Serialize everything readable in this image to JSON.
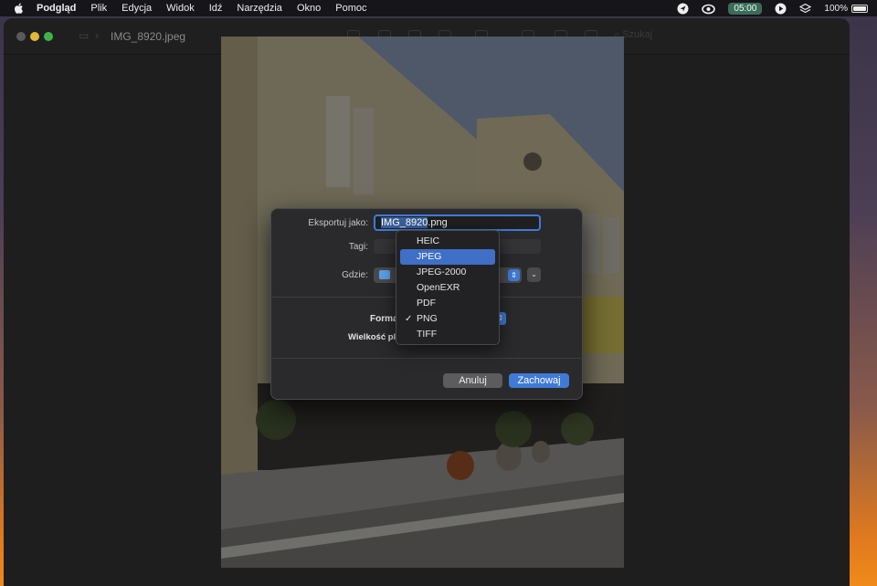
{
  "menubar": {
    "app_name": "Podgląd",
    "items": [
      "Plik",
      "Edycja",
      "Widok",
      "Idź",
      "Narzędzia",
      "Okno",
      "Pomoc"
    ],
    "clock": "05:00",
    "battery": "100%"
  },
  "window": {
    "title": "IMG_8920.jpeg",
    "search_placeholder": "Szukaj"
  },
  "export_sheet": {
    "export_as_label": "Eksportuj jako:",
    "filename_selected": "IMG_8920",
    "filename_ext": ".png",
    "tags_label": "Tagi:",
    "where_label": "Gdzie:",
    "format_label": "Forma",
    "filesize_label": "Wielkość plik",
    "cancel": "Anuluj",
    "save": "Zachowaj"
  },
  "format_menu": {
    "options": [
      "HEIC",
      "JPEG",
      "JPEG-2000",
      "OpenEXR",
      "PDF",
      "PNG",
      "TIFF"
    ],
    "highlighted": "JPEG",
    "checked": "PNG"
  },
  "colors": {
    "accent": "#3f7ad6",
    "sheet_bg": "#2a2a2c"
  }
}
